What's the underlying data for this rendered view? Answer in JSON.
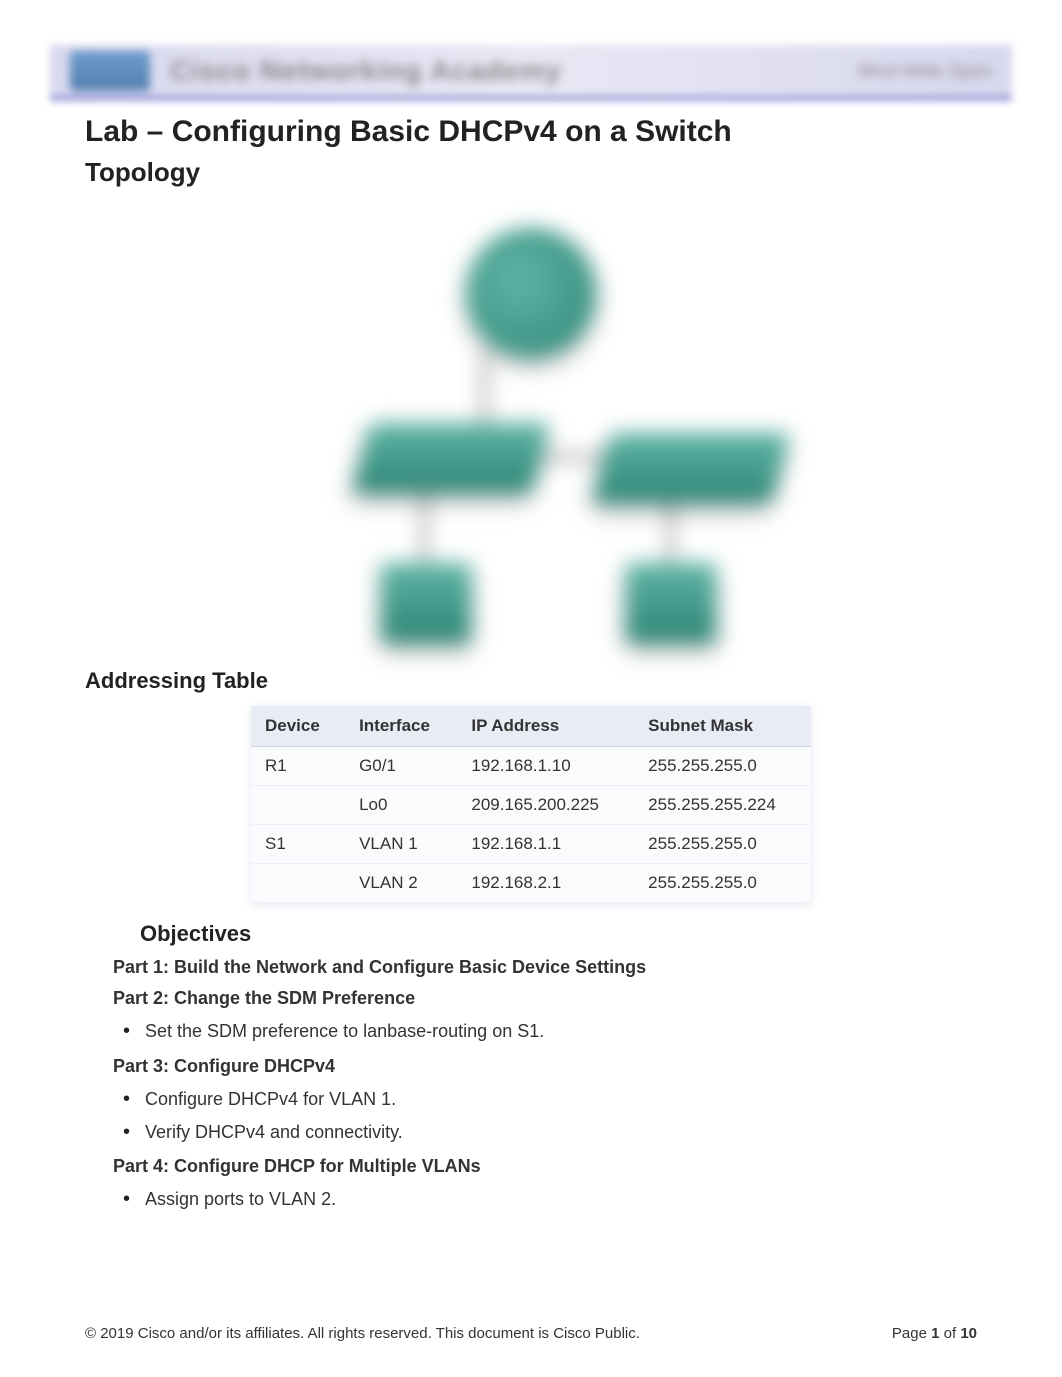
{
  "header": {
    "brand_text": "Cisco Networking Academy",
    "right_text": "Mind Wide Open"
  },
  "title": "Lab – Configuring Basic DHCPv4 on a Switch",
  "topology_heading": "Topology",
  "addressing_heading": "Addressing Table",
  "addressing_table": {
    "headers": [
      "Device",
      "Interface",
      "IP Address",
      "Subnet Mask"
    ],
    "rows": [
      [
        "R1",
        "G0/1",
        "192.168.1.10",
        "255.255.255.0"
      ],
      [
        "",
        "Lo0",
        "209.165.200.225",
        "255.255.255.224"
      ],
      [
        "S1",
        "VLAN 1",
        "192.168.1.1",
        "255.255.255.0"
      ],
      [
        "",
        "VLAN 2",
        "192.168.2.1",
        "255.255.255.0"
      ]
    ]
  },
  "objectives_heading": "Objectives",
  "parts": [
    {
      "title": "Part 1: Build the Network and Configure Basic Device Settings",
      "bullets": []
    },
    {
      "title": "Part 2: Change the SDM Preference",
      "bullets": [
        "Set the SDM preference to lanbase-routing on S1."
      ]
    },
    {
      "title": "Part 3: Configure DHCPv4",
      "bullets": [
        "Configure DHCPv4 for VLAN 1.",
        "Verify DHCPv4 and connectivity."
      ]
    },
    {
      "title": "Part 4: Configure DHCP for Multiple VLANs",
      "bullets": [
        "Assign ports to VLAN 2."
      ]
    }
  ],
  "footer": {
    "copyright": "© 2019 Cisco and/or its affiliates. All rights reserved. This document is Cisco Public.",
    "page_prefix": "Page ",
    "page_current": "1",
    "page_sep": " of ",
    "page_total": "10"
  }
}
